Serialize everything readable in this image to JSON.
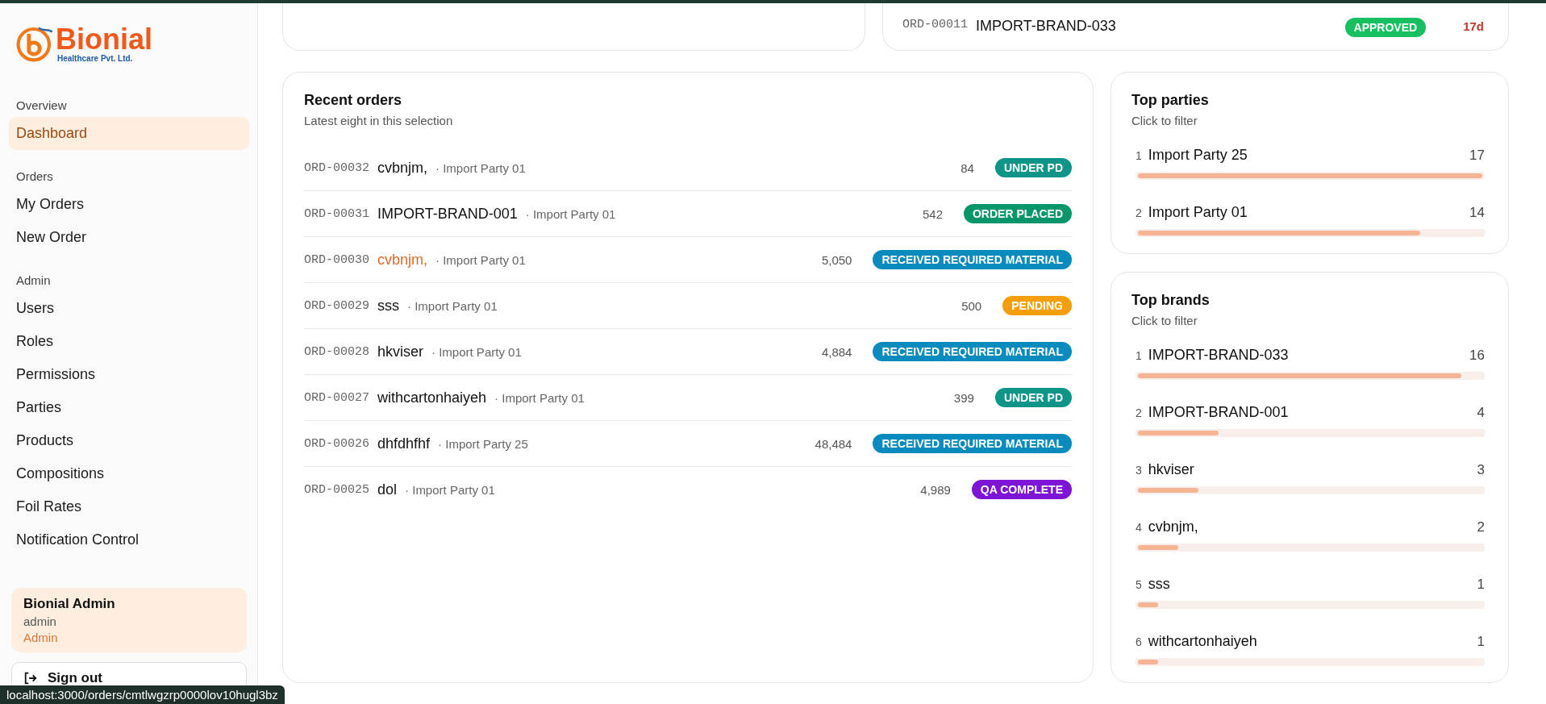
{
  "logo": {
    "name": "Bionial",
    "tagline": "Healthcare Pvt. Ltd."
  },
  "sidebar": {
    "sections": [
      {
        "heading": "Overview",
        "items": [
          {
            "label": "Dashboard",
            "selected": true
          }
        ]
      },
      {
        "heading": "Orders",
        "items": [
          {
            "label": "My Orders",
            "selected": false
          },
          {
            "label": "New Order",
            "selected": false
          }
        ]
      },
      {
        "heading": "Admin",
        "items": [
          {
            "label": "Users",
            "selected": false
          },
          {
            "label": "Roles",
            "selected": false
          },
          {
            "label": "Permissions",
            "selected": false
          },
          {
            "label": "Parties",
            "selected": false
          },
          {
            "label": "Products",
            "selected": false
          },
          {
            "label": "Compositions",
            "selected": false
          },
          {
            "label": "Foil Rates",
            "selected": false
          },
          {
            "label": "Notification Control",
            "selected": false
          }
        ]
      }
    ],
    "user": {
      "name": "Bionial Admin",
      "username": "admin",
      "role": "Admin"
    },
    "sign_out": "Sign out"
  },
  "top_right_card": {
    "order_id": "ORD-00011",
    "brand": "IMPORT-BRAND-033",
    "status": "APPROVED",
    "color": "#16c060",
    "age": "17d"
  },
  "recent_orders": {
    "title": "Recent orders",
    "subtitle": "Latest eight in this selection",
    "rows": [
      {
        "order_id": "ORD-00032",
        "brand": "cvbnjm,",
        "party": "· Import Party 01",
        "quantity": "84",
        "status": "UNDER PD",
        "color": "#0f9488",
        "highlighted": false
      },
      {
        "order_id": "ORD-00031",
        "brand": "IMPORT-BRAND-001",
        "party": "· Import Party 01",
        "quantity": "542",
        "status": "ORDER PLACED",
        "color": "#079669",
        "highlighted": false
      },
      {
        "order_id": "ORD-00030",
        "brand": "cvbnjm,",
        "party": "· Import Party 01",
        "quantity": "5,050",
        "status": "RECEIVED REQUIRED MATERIAL",
        "color": "#0a8bbd",
        "highlighted": true
      },
      {
        "order_id": "ORD-00029",
        "brand": "sss",
        "party": "· Import Party 01",
        "quantity": "500",
        "status": "PENDING",
        "color": "#f59e0b",
        "highlighted": false
      },
      {
        "order_id": "ORD-00028",
        "brand": "hkviser",
        "party": "· Import Party 01",
        "quantity": "4,884",
        "status": "RECEIVED REQUIRED MATERIAL",
        "color": "#0a8bbd",
        "highlighted": false
      },
      {
        "order_id": "ORD-00027",
        "brand": "withcartonhaiyeh",
        "party": "· Import Party 01",
        "quantity": "399",
        "status": "UNDER PD",
        "color": "#0f9488",
        "highlighted": false
      },
      {
        "order_id": "ORD-00026",
        "brand": "dhfdhfhf",
        "party": "· Import Party 25",
        "quantity": "48,484",
        "status": "RECEIVED REQUIRED MATERIAL",
        "color": "#0a8bbd",
        "highlighted": false
      },
      {
        "order_id": "ORD-00025",
        "brand": "dol",
        "party": "· Import Party 01",
        "quantity": "4,989",
        "status": "QA COMPLETE",
        "color": "#7e14d6",
        "highlighted": false
      }
    ]
  },
  "top_parties": {
    "title": "Top parties",
    "subtitle": "Click to filter",
    "items": [
      {
        "rank": "1",
        "name": "Import Party 25",
        "count": "17",
        "level": 1.0
      },
      {
        "rank": "2",
        "name": "Import Party 01",
        "count": "14",
        "level": 0.82
      }
    ]
  },
  "top_brands": {
    "title": "Top brands",
    "subtitle": "Click to filter",
    "items": [
      {
        "rank": "1",
        "name": "IMPORT-BRAND-033",
        "count": "16",
        "level": 0.94
      },
      {
        "rank": "2",
        "name": "IMPORT-BRAND-001",
        "count": "4",
        "level": 0.235
      },
      {
        "rank": "3",
        "name": "hkviser",
        "count": "3",
        "level": 0.176
      },
      {
        "rank": "4",
        "name": "cvbnjm,",
        "count": "2",
        "level": 0.118
      },
      {
        "rank": "5",
        "name": "sss",
        "count": "1",
        "level": 0.059
      },
      {
        "rank": "6",
        "name": "withcartonhaiyeh",
        "count": "1",
        "level": 0.059
      }
    ]
  },
  "status_bar": {
    "url": "localhost:3000/orders/cmtlwgzrp0000lov10hugl3bz"
  }
}
